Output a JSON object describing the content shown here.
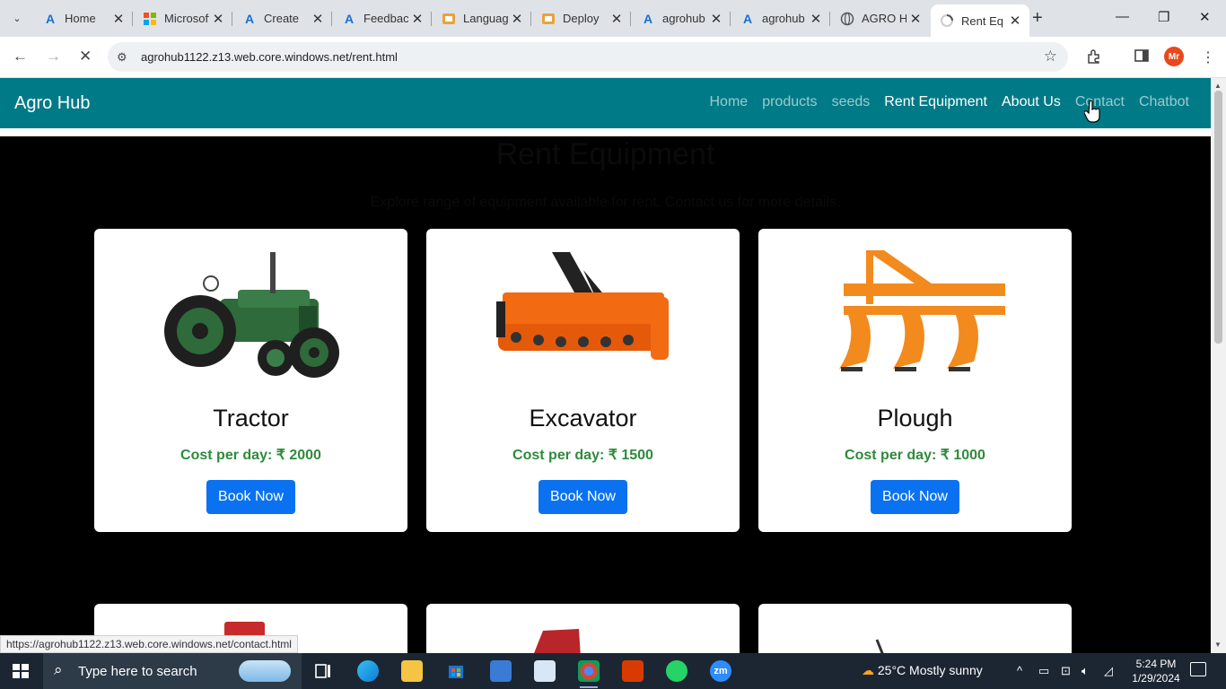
{
  "browser": {
    "tabs": [
      {
        "title": "Home",
        "favicon": "azure-icon",
        "active": false
      },
      {
        "title": "Microsoft",
        "favicon": "microsoft-icon",
        "active": false
      },
      {
        "title": "Create",
        "favicon": "azure-icon",
        "active": false
      },
      {
        "title": "Feedback",
        "favicon": "azure-icon",
        "active": false
      },
      {
        "title": "Language",
        "favicon": "language-icon",
        "active": false
      },
      {
        "title": "Deploy",
        "favicon": "deploy-icon",
        "active": false
      },
      {
        "title": "agrohub",
        "favicon": "azure-icon",
        "active": false
      },
      {
        "title": "agrohub",
        "favicon": "azure-icon",
        "active": false
      },
      {
        "title": "AGRO H",
        "favicon": "globe-icon",
        "active": false
      },
      {
        "title": "Rent Eq",
        "favicon": "loading-icon",
        "active": true
      }
    ],
    "url": "agrohub1122.z13.web.core.windows.net/rent.html",
    "status_url": "https://agrohub1122.z13.web.core.windows.net/contact.html",
    "profile_initials": "Mr"
  },
  "site": {
    "brand": "Agro Hub",
    "nav": [
      {
        "label": "Home",
        "active": false
      },
      {
        "label": "products",
        "active": false
      },
      {
        "label": "seeds",
        "active": false
      },
      {
        "label": "Rent Equipment",
        "active": true
      },
      {
        "label": "About Us",
        "active": false
      },
      {
        "label": "Contact",
        "active": false
      },
      {
        "label": "Chatbot",
        "active": false
      }
    ],
    "title": "Rent Equipment",
    "subtitle": "Explore range of equipment available for rent. Contact us for more details.",
    "equipment": [
      {
        "name": "Tractor",
        "cost": "Cost per day: ₹ 2000",
        "button": "Book Now",
        "image": "tractor-image"
      },
      {
        "name": "Excavator",
        "cost": "Cost per day: ₹ 1500",
        "button": "Book Now",
        "image": "rotavator-image"
      },
      {
        "name": "Plough",
        "cost": "Cost per day: ₹ 1000",
        "button": "Book Now",
        "image": "plough-image"
      }
    ],
    "colors": {
      "navbar": "#007a87",
      "cost": "#2e8b3a",
      "button": "#0a72f0"
    }
  },
  "taskbar": {
    "search_placeholder": "Type here to search",
    "weather": "25°C  Mostly sunny",
    "time": "5:24 PM",
    "date": "1/29/2024"
  }
}
